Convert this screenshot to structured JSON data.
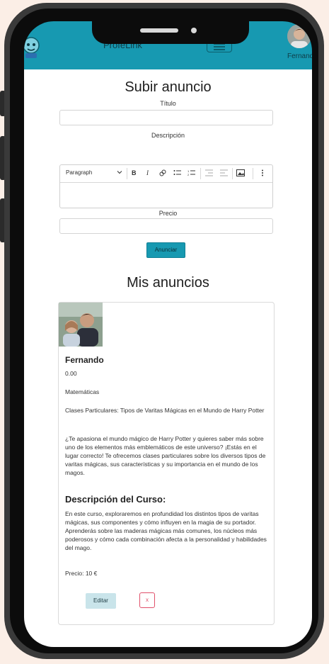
{
  "navbar": {
    "brand": "ProfeLink",
    "user_name": "Fernando"
  },
  "upload": {
    "title": "Subir anuncio",
    "title_label": "Título",
    "description_label": "Descripción",
    "toolbar": {
      "block_format": "Paragraph",
      "bold": "B",
      "italic": "I"
    },
    "price_label": "Precio",
    "submit_label": "Anunciar"
  },
  "my_ads": {
    "title": "Mis anuncios",
    "card": {
      "name": "Fernando",
      "price_value": "0.00",
      "subject": "Matemáticas",
      "headline": "Clases Particulares: Tipos de Varitas Mágicas en el Mundo de Harry Potter",
      "intro": "¿Te apasiona el mundo mágico de Harry Potter y quieres saber más sobre uno de los elementos más emblemáticos de este universo? ¡Estás en el lugar correcto! Te ofrecemos clases particulares sobre los diversos tipos de varitas mágicas, sus características y su importancia en el mundo de los magos.",
      "course_heading": "Descripción del Curso:",
      "course_text": "En este curso, exploraremos en profundidad los distintos tipos de varitas mágicas, sus componentes y cómo influyen en la magia de su portador. Aprenderás sobre las maderas mágicas más comunes, los núcleos más poderosos y cómo cada combinación afecta a la personalidad y habilidades del mago.",
      "price_line": "Precio: 10 €",
      "edit_label": "Editar",
      "delete_label": "x"
    }
  },
  "colors": {
    "navbar": "#1799b1",
    "primary_button": "#1799b1",
    "delete_border": "#e0506a",
    "background": "#fbeee6"
  },
  "icons": [
    "logo-icon",
    "menu-icon",
    "link-icon",
    "bullet-list-icon",
    "numbered-list-icon",
    "outdent-icon",
    "indent-icon",
    "image-icon",
    "more-vertical-icon",
    "chevron-down-icon"
  ]
}
